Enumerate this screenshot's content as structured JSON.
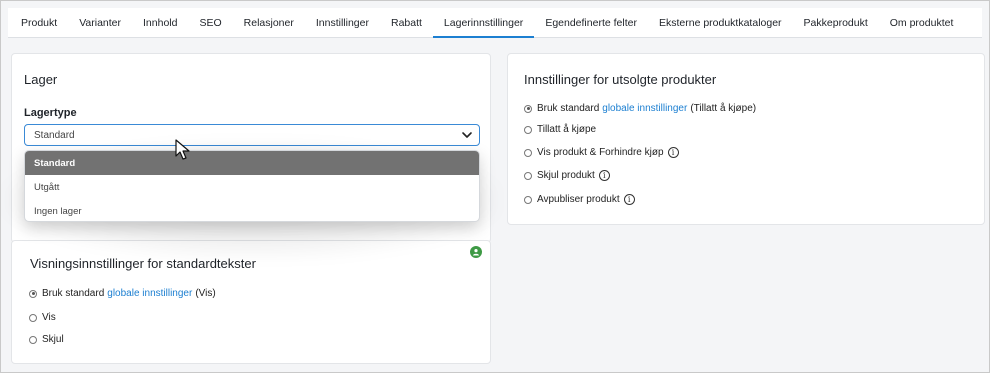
{
  "tabs": [
    {
      "label": "Produkt"
    },
    {
      "label": "Varianter"
    },
    {
      "label": "Innhold"
    },
    {
      "label": "SEO"
    },
    {
      "label": "Relasjoner"
    },
    {
      "label": "Innstillinger"
    },
    {
      "label": "Rabatt"
    },
    {
      "label": "Lagerinnstillinger",
      "active": true
    },
    {
      "label": "Egendefinerte felter"
    },
    {
      "label": "Eksterne produktkataloger"
    },
    {
      "label": "Pakkeprodukt"
    },
    {
      "label": "Om produktet"
    }
  ],
  "lager": {
    "title": "Lager",
    "field_label": "Lagertype",
    "selected_value": "Standard",
    "options": [
      "Standard",
      "Utgått",
      "Ingen lager"
    ]
  },
  "visning": {
    "title": "Visningsinnstillinger for standardtekster",
    "options": [
      {
        "prefix": "Bruk standard",
        "link": "globale innstillinger",
        "suffix": "(Vis)",
        "checked": true
      },
      {
        "label": "Vis"
      },
      {
        "label": "Skjul"
      }
    ]
  },
  "utsolgte": {
    "title": "Innstillinger for utsolgte produkter",
    "options": [
      {
        "prefix": "Bruk standard",
        "link": "globale innstillinger",
        "suffix": "(Tillatt å kjøpe)",
        "checked": true
      },
      {
        "label": "Tillatt å kjøpe"
      },
      {
        "label": "Vis produkt & Forhindre kjøp",
        "info": true
      },
      {
        "label": "Skjul produkt",
        "info": true
      },
      {
        "label": "Avpubliser produkt",
        "info": true
      }
    ]
  },
  "colors": {
    "accent": "#1c7fd1",
    "dropdown_selected": "#727272",
    "badge": "#3e9a45"
  }
}
